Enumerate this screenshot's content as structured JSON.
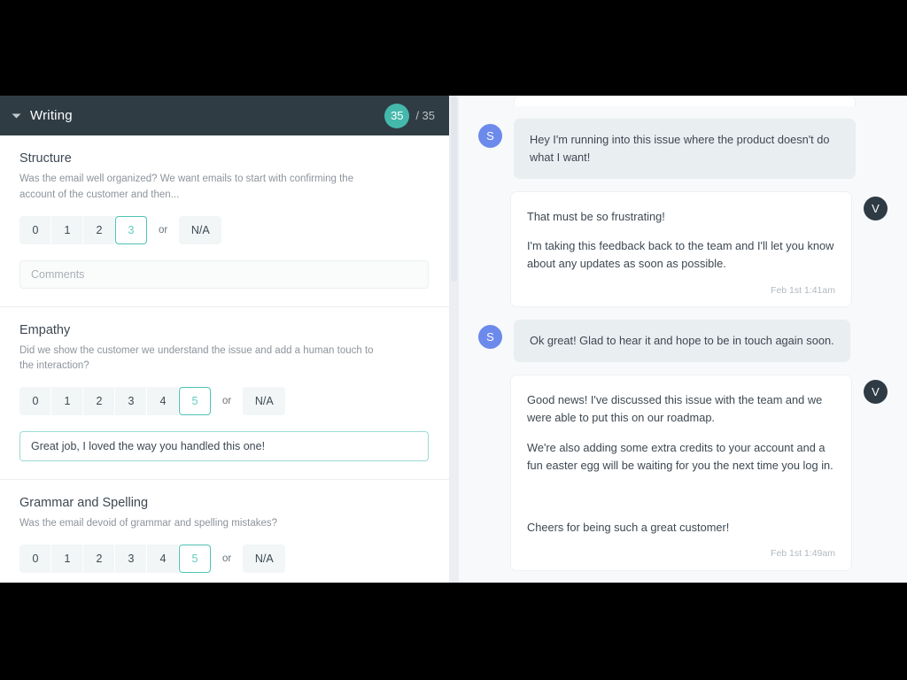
{
  "scorecard": {
    "header": {
      "caret_icon": "chevron-down-icon",
      "title": "Writing",
      "score": "35",
      "score_total": "/ 35",
      "badge_color": "#45b8ac"
    },
    "sections": [
      {
        "title": "Structure",
        "description": "Was the email well organized? We want emails to start with confirming the account of the customer and then...",
        "options": [
          "0",
          "1",
          "2",
          "3"
        ],
        "selected": "3",
        "or_label": "or",
        "na_label": "N/A",
        "comment_value": "",
        "comment_placeholder": "Comments"
      },
      {
        "title": "Empathy",
        "description": "Did we show the customer we understand the issue and add a human touch to the interaction?",
        "options": [
          "0",
          "1",
          "2",
          "3",
          "4",
          "5"
        ],
        "selected": "5",
        "or_label": "or",
        "na_label": "N/A",
        "comment_value": "Great job, I loved the way you handled this one!",
        "comment_placeholder": "Comments"
      },
      {
        "title": "Grammar and Spelling",
        "description": "Was the email devoid of grammar and spelling mistakes?",
        "options": [
          "0",
          "1",
          "2",
          "3",
          "4",
          "5"
        ],
        "selected": "5",
        "or_label": "or",
        "na_label": "N/A",
        "comment_value": null,
        "comment_placeholder": "Comments"
      }
    ]
  },
  "chat": {
    "messages": [
      {
        "id": "m0",
        "role": "agent",
        "partial": true,
        "avatar": null,
        "paragraphs": [],
        "timestamp": null
      },
      {
        "id": "m1",
        "role": "customer",
        "avatar": "S",
        "paragraphs": [
          "Hey I'm running into this issue where the product doesn't do what I want!"
        ],
        "timestamp": null
      },
      {
        "id": "m2",
        "role": "agent",
        "avatar": "V",
        "paragraphs": [
          "That must be so frustrating!",
          "I'm taking this feedback back to the team and I'll let you know about any updates as soon as possible."
        ],
        "timestamp": "Feb 1st 1:41am"
      },
      {
        "id": "m3",
        "role": "customer",
        "avatar": "S",
        "paragraphs": [
          "Ok great! Glad to hear it and hope to be in touch again soon."
        ],
        "timestamp": null
      },
      {
        "id": "m4",
        "role": "agent",
        "avatar": "V",
        "paragraphs": [
          "Good news! I've discussed this issue with the team and we were able to put this on our roadmap.",
          "We're also adding some extra credits to your account and a fun easter egg will be waiting for you the next time you log in.",
          "",
          "Cheers for being such a great customer!"
        ],
        "timestamp": "Feb 1st 1:49am"
      }
    ],
    "customer_avatar_color": "#6c8aec",
    "agent_avatar_color": "#2e3a44"
  }
}
